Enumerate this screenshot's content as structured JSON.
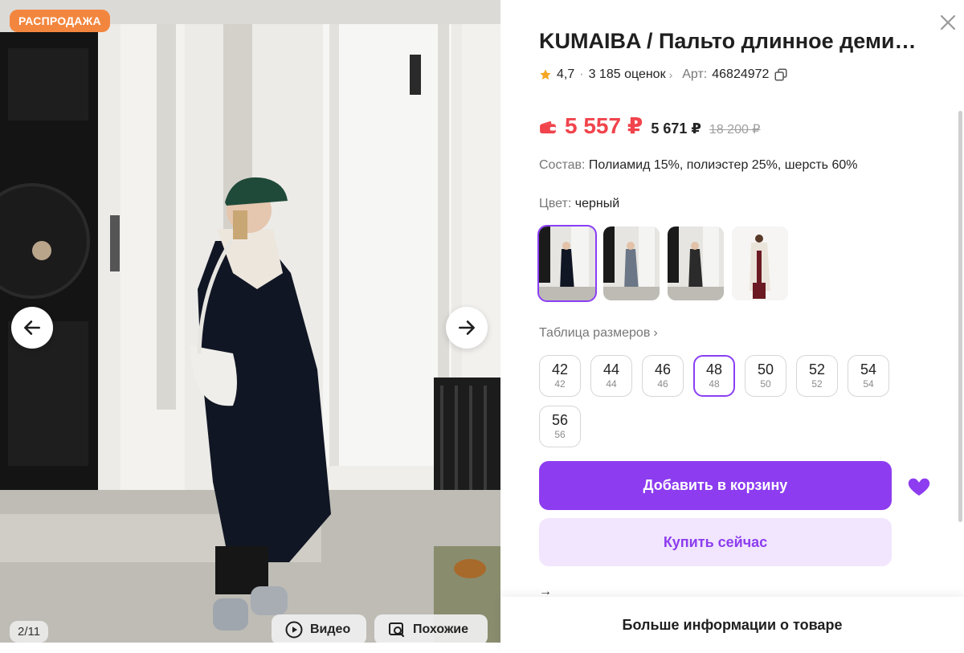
{
  "gallery": {
    "badge": "РАСПРОДАЖА",
    "counter": "2/11",
    "video_label": "Видео",
    "similar_label": "Похожие"
  },
  "product": {
    "title": "KUMAIBA / Пальто длинное деми…",
    "rating": "4,7",
    "reviews": "3 185 оценок",
    "article_label": "Арт:",
    "article": "46824972",
    "price_wallet_main": "5 557 ₽",
    "price_regular": "5 671 ₽",
    "price_old": "18 200 ₽",
    "composition_label": "Состав:",
    "composition": "Полиамид 15%, полиэстер 25%, шерсть 60%",
    "color_label": "Цвет:",
    "color_value": "черный",
    "size_table": "Таблица размеров",
    "sizes": [
      {
        "n": "42",
        "s": "42"
      },
      {
        "n": "44",
        "s": "44"
      },
      {
        "n": "46",
        "s": "46"
      },
      {
        "n": "48",
        "s": "48"
      },
      {
        "n": "50",
        "s": "50"
      },
      {
        "n": "52",
        "s": "52"
      },
      {
        "n": "54",
        "s": "54"
      },
      {
        "n": "56",
        "s": "56"
      }
    ],
    "selected_size": "48",
    "add_to_cart": "Добавить в корзину",
    "buy_now": "Купить сейчас",
    "more_info": "Больше информации о товаре"
  },
  "colors": {
    "accent": "#8d3cf0",
    "accent_light": "#f1e6fd",
    "price_red": "#f1444c",
    "badge_orange": "#f3863f"
  },
  "icons": [
    "arrow-left-icon",
    "arrow-right-icon",
    "play-icon",
    "search-similar-icon",
    "close-icon",
    "star-icon",
    "copy-icon",
    "wallet-icon",
    "heart-icon",
    "chevron-right-icon"
  ]
}
